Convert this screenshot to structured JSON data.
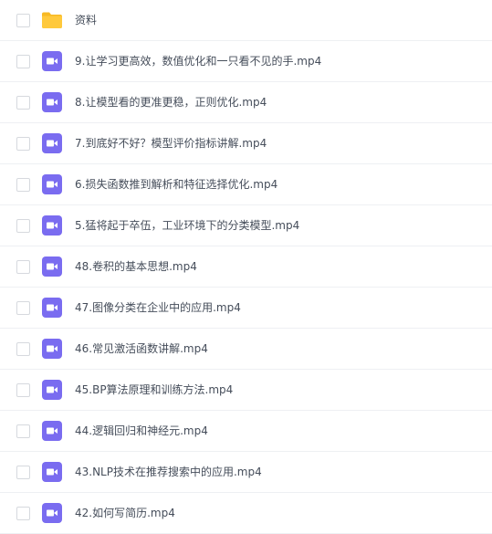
{
  "files": [
    {
      "type": "folder",
      "icon": "folder-icon",
      "name": "资料"
    },
    {
      "type": "video",
      "icon": "video-file-icon",
      "name": "9.让学习更高效，数值优化和一只看不见的手.mp4"
    },
    {
      "type": "video",
      "icon": "video-file-icon",
      "name": "8.让模型看的更准更稳，正则优化.mp4"
    },
    {
      "type": "video",
      "icon": "video-file-icon",
      "name": "7.到底好不好？模型评价指标讲解.mp4"
    },
    {
      "type": "video",
      "icon": "video-file-icon",
      "name": "6.损失函数推到解析和特征选择优化.mp4"
    },
    {
      "type": "video",
      "icon": "video-file-icon",
      "name": "5.猛将起于卒伍，工业环境下的分类模型.mp4"
    },
    {
      "type": "video",
      "icon": "video-file-icon",
      "name": "48.卷积的基本思想.mp4"
    },
    {
      "type": "video",
      "icon": "video-file-icon",
      "name": "47.图像分类在企业中的应用.mp4"
    },
    {
      "type": "video",
      "icon": "video-file-icon",
      "name": "46.常见激活函数讲解.mp4"
    },
    {
      "type": "video",
      "icon": "video-file-icon",
      "name": "45.BP算法原理和训练方法.mp4"
    },
    {
      "type": "video",
      "icon": "video-file-icon",
      "name": "44.逻辑回归和神经元.mp4"
    },
    {
      "type": "video",
      "icon": "video-file-icon",
      "name": "43.NLP技术在推荐搜索中的应用.mp4"
    },
    {
      "type": "video",
      "icon": "video-file-icon",
      "name": "42.如何写简历.mp4"
    }
  ],
  "colors": {
    "folder": "#ffc93c",
    "folder_tab": "#f7b924",
    "video": "#7a6cf0",
    "text": "#454d5a",
    "divider": "#eef0f3"
  }
}
